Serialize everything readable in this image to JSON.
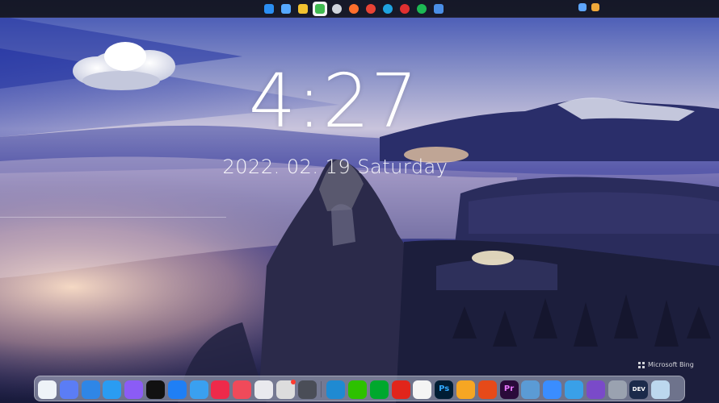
{
  "lockscreen": {
    "time": "4:27",
    "date": "2022. 02. 19  Saturday"
  },
  "wallpaper": {
    "credit_text": "Microsoft Bing",
    "credit_icon": "bing-logo-icon"
  },
  "colors": {
    "taskbar_bg": "#14161c",
    "dock_bg": "#b2bace",
    "sky_deep": "#1c2d8c",
    "glow": "#ffd9b8",
    "forest": "#1a1c38"
  },
  "taskbar": {
    "items": [
      {
        "icon": "windows-start-icon",
        "color": "#2b8ef3",
        "active": false
      },
      {
        "icon": "task-view-icon",
        "color": "#56a8ff",
        "active": false
      },
      {
        "icon": "file-explorer-icon",
        "color": "#f2c230",
        "active": false
      },
      {
        "icon": "android-app-icon",
        "color": "#3fb950",
        "active": true
      },
      {
        "icon": "cloud-app-icon",
        "color": "#cfd4dd",
        "active": false
      },
      {
        "icon": "firefox-icon",
        "color": "#ff6f2c",
        "active": false
      },
      {
        "icon": "chrome-icon",
        "color": "#e94335",
        "active": false
      },
      {
        "icon": "edge-icon",
        "color": "#1fa3e0",
        "active": false
      },
      {
        "icon": "netease-music-icon",
        "color": "#e03030",
        "active": false
      },
      {
        "icon": "spotify-icon",
        "color": "#1db954",
        "active": false
      },
      {
        "icon": "terminal-icon",
        "color": "#4a8ee6",
        "active": false
      }
    ],
    "tray": [
      {
        "icon": "shield-tray-icon",
        "color": "#5ea6ff"
      },
      {
        "icon": "color-tray-icon",
        "color": "#f0a93a"
      }
    ]
  },
  "dock": {
    "items": [
      {
        "icon": "finder-icon",
        "color": "#eef3f8",
        "glyph": ""
      },
      {
        "icon": "launchpad-icon",
        "color": "#5b7df5",
        "glyph": ""
      },
      {
        "icon": "desktop-icon",
        "color": "#2f86e6",
        "glyph": ""
      },
      {
        "icon": "safari-icon",
        "color": "#2a9cf2",
        "glyph": ""
      },
      {
        "icon": "siri-icon",
        "color": "#8b5cf6",
        "glyph": ""
      },
      {
        "icon": "black-app-icon",
        "color": "#111111",
        "glyph": ""
      },
      {
        "icon": "app-store-icon",
        "color": "#1f7ff5",
        "glyph": ""
      },
      {
        "icon": "spotlight-search-icon",
        "color": "#3aa0f0",
        "glyph": ""
      },
      {
        "icon": "photo-booth-icon",
        "color": "#ee2a4a",
        "glyph": ""
      },
      {
        "icon": "red-app-icon",
        "color": "#f04a5a",
        "glyph": ""
      },
      {
        "icon": "control-center-icon",
        "color": "#e9e9ee",
        "glyph": ""
      },
      {
        "icon": "messages-icon",
        "color": "#dddddd",
        "glyph": ""
      },
      {
        "icon": "power-icon",
        "color": "#4a4d57",
        "glyph": ""
      },
      {
        "icon": "vscode-icon",
        "color": "#1f8ad2",
        "glyph": ""
      },
      {
        "icon": "wechat-icon",
        "color": "#2dc100",
        "glyph": ""
      },
      {
        "icon": "evernote-icon",
        "color": "#00a82d",
        "glyph": ""
      },
      {
        "icon": "netease-cloud-music-icon",
        "color": "#e1251b",
        "glyph": ""
      },
      {
        "icon": "chrome-icon",
        "color": "#f4f4f4",
        "glyph": ""
      },
      {
        "icon": "photoshop-icon",
        "color": "#001d34",
        "glyph": "Ps"
      },
      {
        "icon": "folder-app-icon",
        "color": "#f6a623",
        "glyph": ""
      },
      {
        "icon": "office-icon",
        "color": "#e64a19",
        "glyph": ""
      },
      {
        "icon": "premiere-icon",
        "color": "#2a0a3a",
        "glyph": "Pr"
      },
      {
        "icon": "preview-icon",
        "color": "#5b9bd5",
        "glyph": ""
      },
      {
        "icon": "baidu-netdisk-icon",
        "color": "#3a8dff",
        "glyph": ""
      },
      {
        "icon": "typora-icon",
        "color": "#39a0e8",
        "glyph": ""
      },
      {
        "icon": "visual-studio-icon",
        "color": "#7a4ac9",
        "glyph": ""
      },
      {
        "icon": "disk-utility-icon",
        "color": "#9aa2b0",
        "glyph": ""
      },
      {
        "icon": "dev-app-icon",
        "color": "#1b2a4a",
        "glyph": "DEV"
      },
      {
        "icon": "recycle-bin-icon",
        "color": "#bcd7ee",
        "glyph": ""
      }
    ]
  }
}
